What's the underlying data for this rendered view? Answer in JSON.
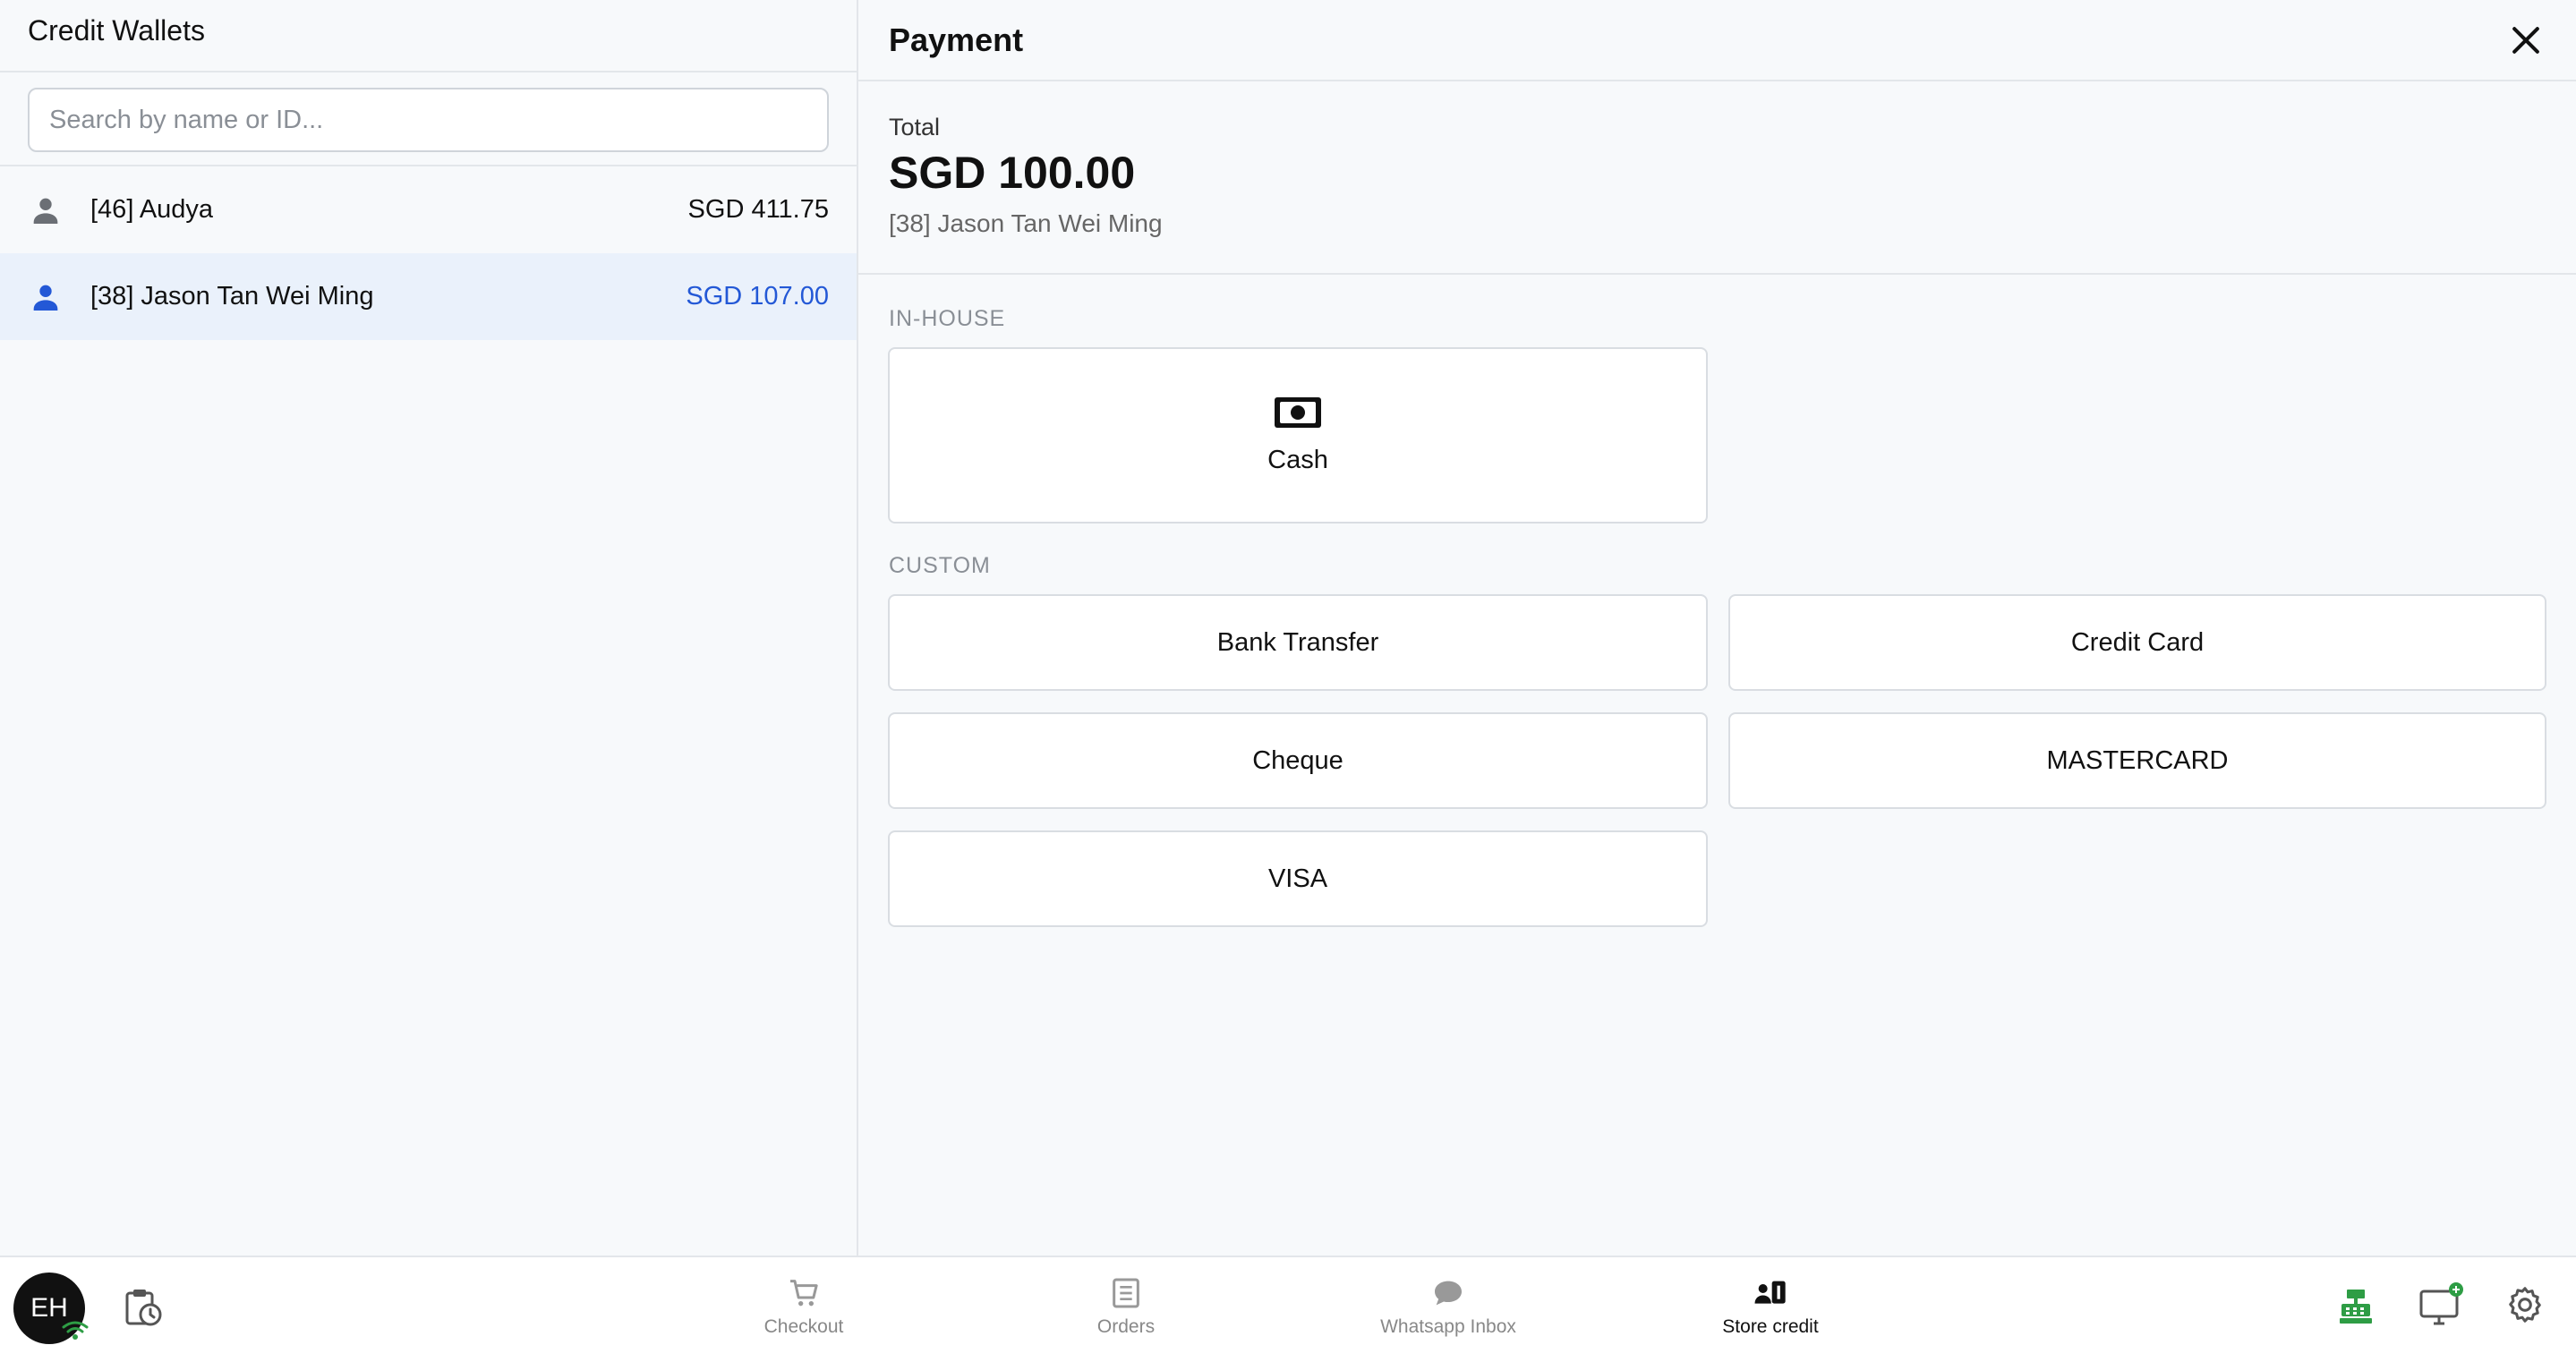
{
  "wallets": {
    "title": "Credit Wallets",
    "search_placeholder": "Search by name or ID...",
    "items": [
      {
        "name": "[46] Audya",
        "balance": "SGD 411.75"
      },
      {
        "name": "[38] Jason Tan Wei Ming",
        "balance": "SGD 107.00",
        "selected": true
      }
    ]
  },
  "payment": {
    "title": "Payment",
    "total_label": "Total",
    "total_amount": "SGD 100.00",
    "customer": "[38] Jason Tan Wei Ming",
    "in_house_label": "IN-HOUSE",
    "in_house_methods": [
      {
        "label": "Cash",
        "icon": "cash-icon"
      }
    ],
    "custom_label": "CUSTOM",
    "custom_methods": [
      "Bank Transfer",
      "Credit Card",
      "Cheque",
      "MASTERCARD",
      "VISA"
    ]
  },
  "bottom_nav": {
    "avatar_initials": "EH",
    "items": [
      {
        "label": "Checkout",
        "icon": "cart-icon"
      },
      {
        "label": "Orders",
        "icon": "orders-icon"
      },
      {
        "label": "Whatsapp Inbox",
        "icon": "chat-icon"
      },
      {
        "label": "Store credit",
        "icon": "store-credit-icon",
        "active": true
      }
    ]
  },
  "colors": {
    "accent": "#2358d6",
    "selected_bg": "#eaf1fb",
    "cash_register_green": "#2e9d45"
  }
}
